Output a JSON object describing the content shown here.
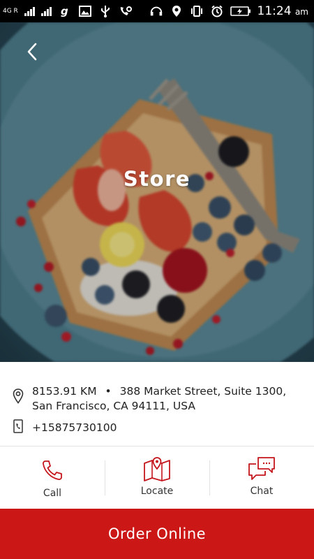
{
  "status_bar": {
    "network_label": "4G R",
    "time": "11:24",
    "ampm": "am"
  },
  "store": {
    "title": "Store",
    "distance": "8153.91 KM",
    "separator": "•",
    "address_line1": "388 Market Street, Suite 1300,",
    "address_line2": "San Francisco, CA 94111, USA",
    "phone": "+15875730100"
  },
  "actions": {
    "call": "Call",
    "locate": "Locate",
    "chat": "Chat"
  },
  "order_button": "Order Online",
  "icons": {
    "back": "back-chevron-icon",
    "location": "location-pin-icon",
    "phone": "phone-book-icon",
    "call": "phone-icon",
    "locate": "map-pin-icon",
    "chat": "chat-bubbles-icon"
  },
  "colors": {
    "accent": "#cc1717",
    "status_bar": "#000000",
    "text": "#222222"
  }
}
